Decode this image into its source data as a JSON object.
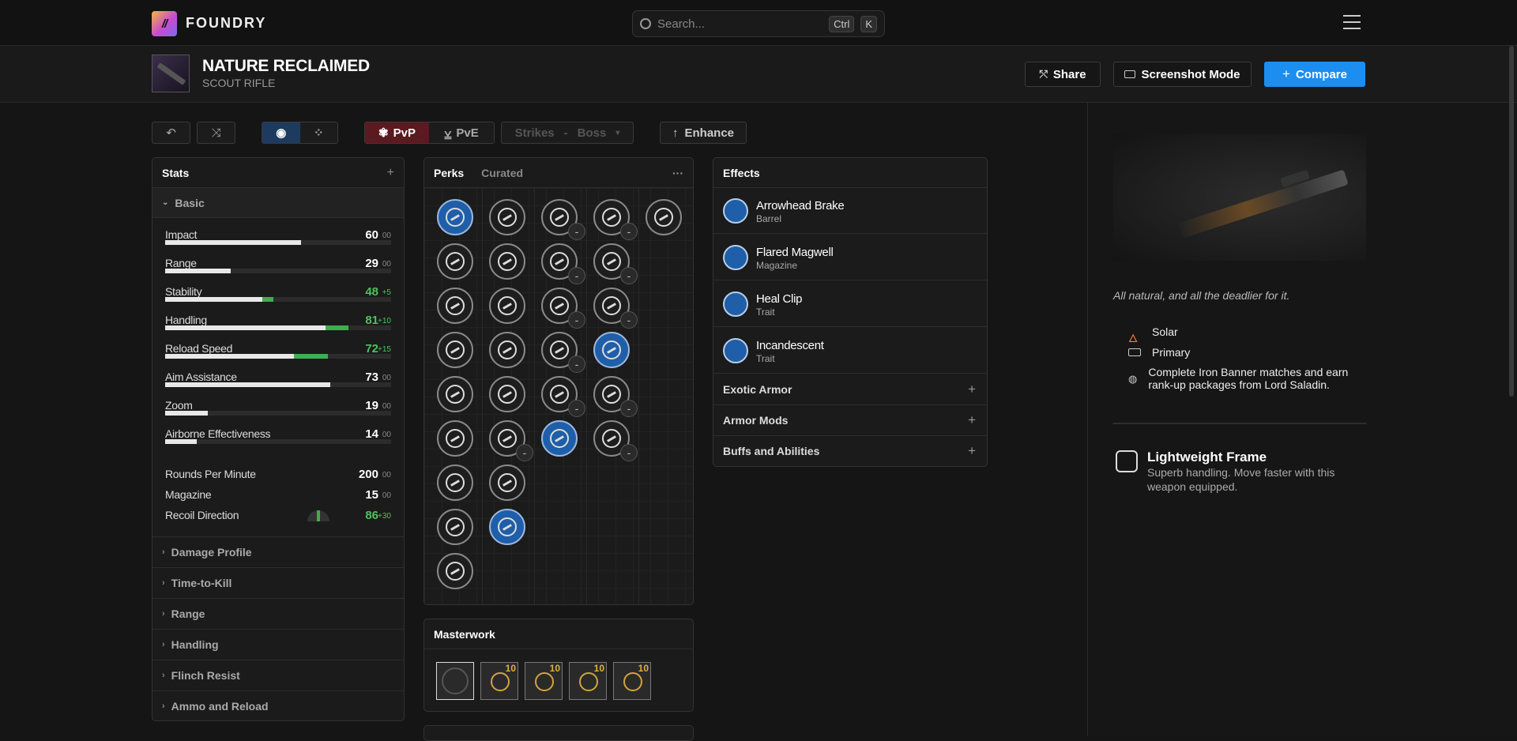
{
  "nav": {
    "brand": "FOUNDRY",
    "logo_text": "//",
    "search_placeholder": "Search...",
    "kbd_ctrl": "Ctrl",
    "kbd_k": "K"
  },
  "weapon": {
    "name": "NATURE RECLAIMED",
    "type": "SCOUT RIFLE"
  },
  "actions": {
    "share": "Share",
    "screenshot": "Screenshot Mode",
    "compare": "Compare"
  },
  "toolbar": {
    "pvp": "PvP",
    "pve": "PvE",
    "strikes": "Strikes",
    "dash": "-",
    "boss": "Boss",
    "enhance": "Enhance"
  },
  "stats": {
    "title": "Stats",
    "section": "Basic",
    "items": [
      {
        "label": "Impact",
        "value": "60",
        "mod": "00",
        "pct": 60,
        "bonus": 0
      },
      {
        "label": "Range",
        "value": "29",
        "mod": "00",
        "pct": 29,
        "bonus": 0
      },
      {
        "label": "Stability",
        "value": "48",
        "mod": "+5",
        "pct": 43,
        "bonus": 5
      },
      {
        "label": "Handling",
        "value": "81",
        "mod": "+10",
        "pct": 71,
        "bonus": 10
      },
      {
        "label": "Reload Speed",
        "value": "72",
        "mod": "+15",
        "pct": 57,
        "bonus": 15
      },
      {
        "label": "Aim Assistance",
        "value": "73",
        "mod": "00",
        "pct": 73,
        "bonus": 0
      },
      {
        "label": "Zoom",
        "value": "19",
        "mod": "00",
        "pct": 19,
        "bonus": 0
      },
      {
        "label": "Airborne Effectiveness",
        "value": "14",
        "mod": "00",
        "pct": 14,
        "bonus": 0
      }
    ],
    "extra": [
      {
        "label": "Rounds Per Minute",
        "value": "200",
        "mod": "00"
      },
      {
        "label": "Magazine",
        "value": "15",
        "mod": "00"
      },
      {
        "label": "Recoil Direction",
        "value": "86",
        "mod": "+30"
      }
    ],
    "sections": [
      "Damage Profile",
      "Time-to-Kill",
      "Range",
      "Handling",
      "Flinch Resist",
      "Ammo and Reload"
    ]
  },
  "perks": {
    "tab_perks": "Perks",
    "tab_curated": "Curated",
    "more": "···",
    "minus": "-"
  },
  "masterwork": {
    "title": "Masterwork",
    "level": "10"
  },
  "effects": {
    "title": "Effects",
    "items": [
      {
        "name": "Arrowhead Brake",
        "type": "Barrel"
      },
      {
        "name": "Flared Magwell",
        "type": "Magazine"
      },
      {
        "name": "Heal Clip",
        "type": "Trait"
      },
      {
        "name": "Incandescent",
        "type": "Trait"
      }
    ],
    "sections": [
      "Exotic Armor",
      "Armor Mods",
      "Buffs and Abilities"
    ]
  },
  "details": {
    "flavor": "All natural, and all the deadlier for it.",
    "element": "Solar",
    "ammo": "Primary",
    "source": "Complete Iron Banner matches and earn rank-up packages from Lord Saladin.",
    "frame_name": "Lightweight Frame",
    "frame_desc": "Superb handling. Move faster with this weapon equipped."
  },
  "colors": {
    "accent": "#1b8ef0",
    "pvp": "#5a1a1f",
    "solar": "#f07a3a",
    "green": "#4cc25d",
    "perk_selected": "#1f5ea8"
  }
}
